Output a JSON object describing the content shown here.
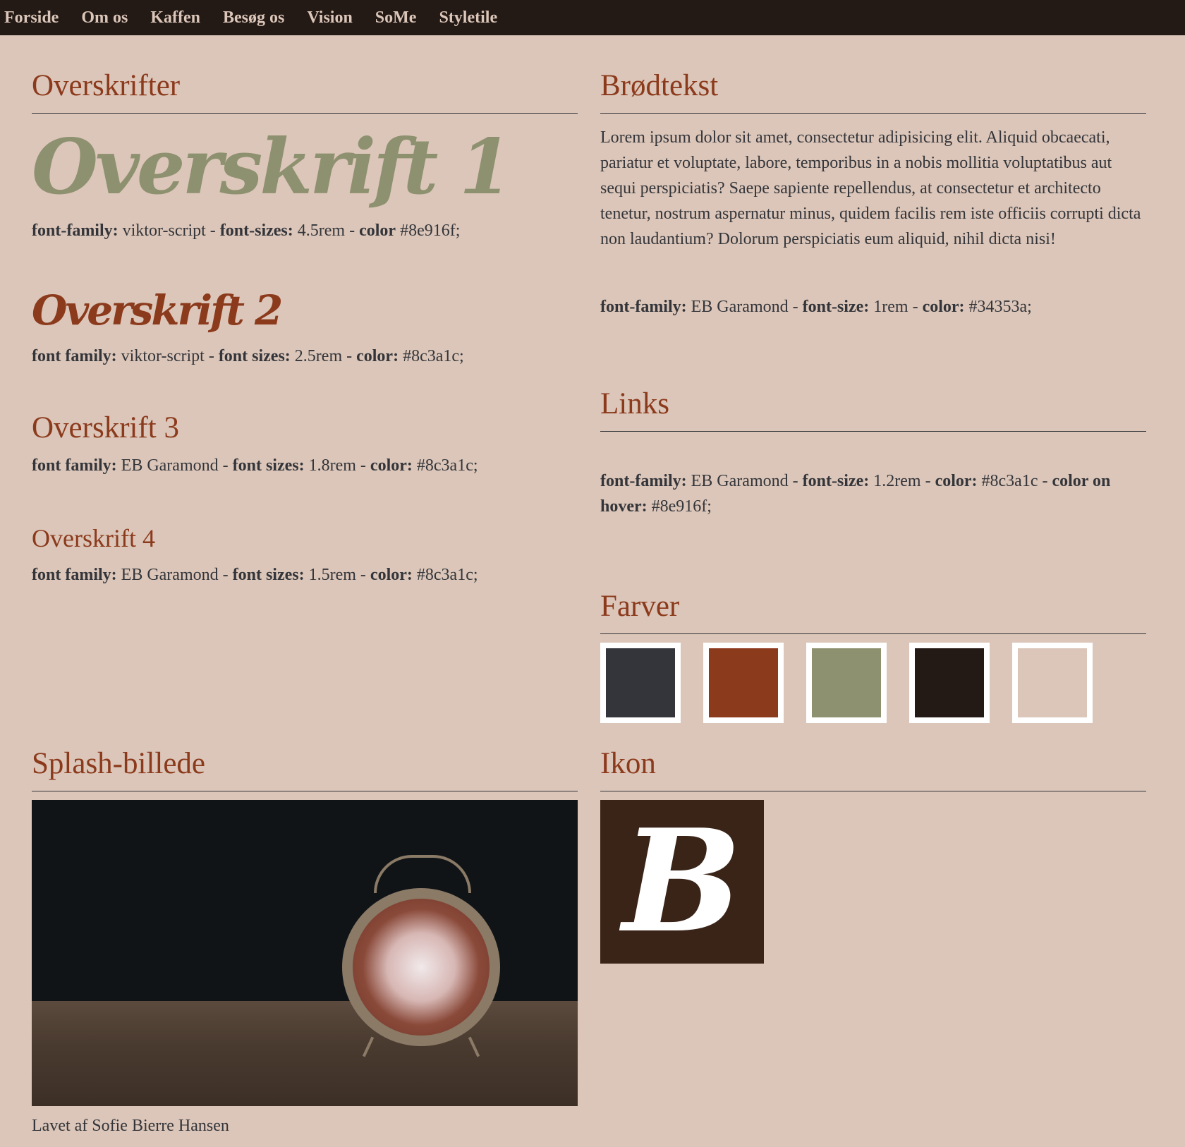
{
  "nav": {
    "items": [
      "Forside",
      "Om os",
      "Kaffen",
      "Besøg os",
      "Vision",
      "SoMe",
      "Styletile"
    ]
  },
  "headings": {
    "title": "Overskrifter",
    "h1": {
      "text": "Overskrift 1",
      "spec": {
        "k1": "font-family:",
        "v1": " viktor-script - ",
        "k2": "font-sizes:",
        "v2": " 4.5rem - ",
        "k3": "color",
        "v3": " #8e916f;"
      }
    },
    "h2": {
      "text": "Overskrift 2",
      "spec": {
        "k1": "font family:",
        "v1": " viktor-script - ",
        "k2": "font sizes:",
        "v2": " 2.5rem - ",
        "k3": "color:",
        "v3": " #8c3a1c;"
      }
    },
    "h3": {
      "text": "Overskrift 3",
      "spec": {
        "k1": "font family:",
        "v1": " EB Garamond - ",
        "k2": "font sizes:",
        "v2": " 1.8rem - ",
        "k3": "color:",
        "v3": " #8c3a1c;"
      }
    },
    "h4": {
      "text": "Overskrift 4",
      "spec": {
        "k1": "font family:",
        "v1": " EB Garamond - ",
        "k2": "font sizes:",
        "v2": " 1.5rem - ",
        "k3": "color:",
        "v3": " #8c3a1c;"
      }
    }
  },
  "body_text": {
    "title": "Brødtekst",
    "sample": "Lorem ipsum dolor sit amet, consectetur adipisicing elit. Aliquid obcaecati, pariatur et voluptate, labore, temporibus in a nobis mollitia voluptatibus aut sequi perspiciatis? Saepe sapiente repellendus, at consectetur et architecto tenetur, nostrum aspernatur minus, quidem facilis rem iste officiis corrupti dicta non laudantium? Dolorum perspiciatis eum aliquid, nihil dicta nisi!",
    "spec": {
      "k1": "font-family:",
      "v1": " EB Garamond - ",
      "k2": "font-size:",
      "v2": " 1rem - ",
      "k3": "color:",
      "v3": " #34353a;"
    }
  },
  "links": {
    "title": "Links",
    "spec": {
      "k1": "font-family:",
      "v1": " EB Garamond - ",
      "k2": "font-size:",
      "v2": " 1.2rem - ",
      "k3": "color:",
      "v3": " #8c3a1c - ",
      "k4": "color on hover:",
      "v4": " #8e916f;"
    }
  },
  "colors": {
    "title": "Farver",
    "swatches": [
      "#34353a",
      "#8c3a1c",
      "#8e916f",
      "#231915",
      "#dbc6b9"
    ]
  },
  "splash": {
    "title": "Splash-billede"
  },
  "icon": {
    "title": "Ikon",
    "letter": "B"
  },
  "footer": {
    "credit": "Lavet af Sofie Bierre Hansen"
  }
}
